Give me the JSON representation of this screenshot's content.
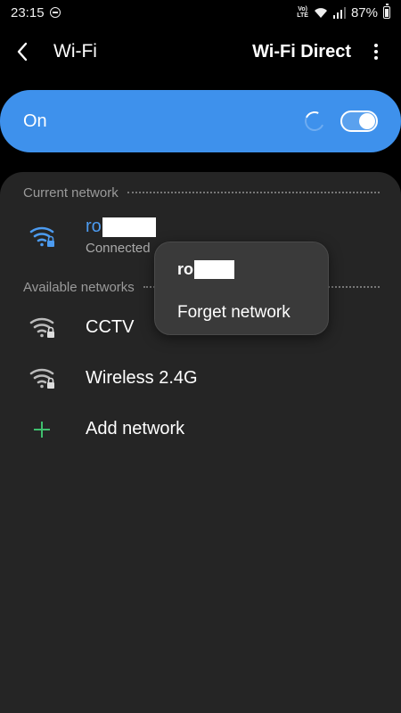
{
  "status_bar": {
    "time": "23:15",
    "volte_top": "Vo)",
    "volte_bottom": "LTE",
    "battery": "87%"
  },
  "header": {
    "title": "Wi-Fi",
    "wifi_direct": "Wi-Fi Direct"
  },
  "toggle_bar": {
    "label": "On",
    "state": "on"
  },
  "current_network": {
    "header": "Current network",
    "name_visible": "ro",
    "status": "Connected"
  },
  "available_networks": {
    "header": "Available networks",
    "items": [
      {
        "name": "CCTV",
        "icon": "wifi-lock-icon"
      },
      {
        "name": "Wireless 2.4G",
        "icon": "wifi-lock-icon"
      }
    ]
  },
  "add_network": {
    "label": "Add network",
    "icon": "plus-icon"
  },
  "popup": {
    "title_visible": "ro",
    "forget_label": "Forget network"
  },
  "colors": {
    "accent_blue": "#3e91ec",
    "connected_blue": "#4c9bf0",
    "card_bg": "#252525",
    "plus_green": "#3fbf6e"
  }
}
